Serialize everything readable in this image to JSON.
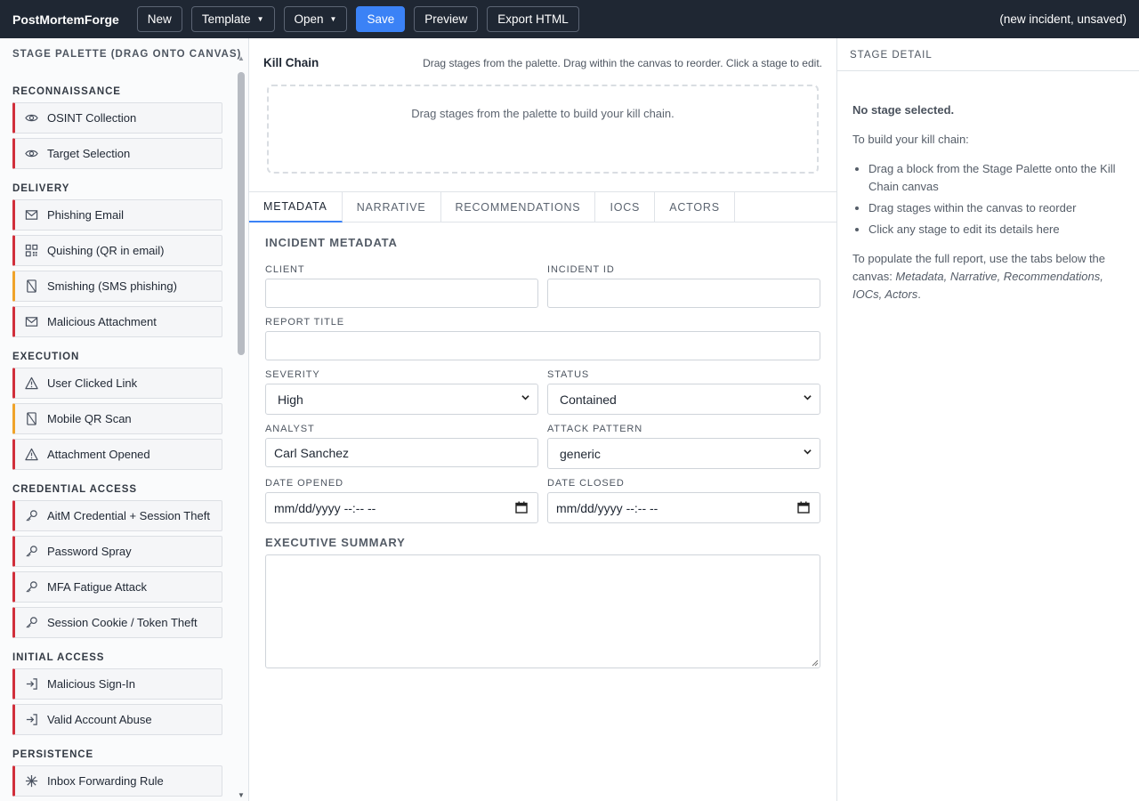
{
  "topbar": {
    "brand": "PostMortemForge",
    "new_label": "New",
    "template_label": "Template",
    "open_label": "Open",
    "save_label": "Save",
    "preview_label": "Preview",
    "export_label": "Export HTML",
    "status": "(new incident, unsaved)"
  },
  "palette": {
    "title": "STAGE PALETTE (DRAG ONTO CANVAS)",
    "categories": [
      {
        "name": "RECONNAISSANCE",
        "items": [
          {
            "label": "OSINT Collection",
            "icon": "eye-icon",
            "color": "#d12f3b"
          },
          {
            "label": "Target Selection",
            "icon": "eye-icon",
            "color": "#d12f3b"
          }
        ]
      },
      {
        "name": "DELIVERY",
        "items": [
          {
            "label": "Phishing Email",
            "icon": "envelope-icon",
            "color": "#d12f3b"
          },
          {
            "label": "Quishing (QR in email)",
            "icon": "qr-code-icon",
            "color": "#d12f3b"
          },
          {
            "label": "Smishing (SMS phishing)",
            "icon": "phone-icon",
            "color": "#f0a32a"
          },
          {
            "label": "Malicious Attachment",
            "icon": "envelope-icon",
            "color": "#d12f3b"
          }
        ]
      },
      {
        "name": "EXECUTION",
        "items": [
          {
            "label": "User Clicked Link",
            "icon": "warning-icon",
            "color": "#d12f3b"
          },
          {
            "label": "Mobile QR Scan",
            "icon": "phone-icon",
            "color": "#f0a32a"
          },
          {
            "label": "Attachment Opened",
            "icon": "warning-icon",
            "color": "#d12f3b"
          }
        ]
      },
      {
        "name": "CREDENTIAL ACCESS",
        "items": [
          {
            "label": "AitM Credential + Session Theft",
            "icon": "key-icon",
            "color": "#d12f3b"
          },
          {
            "label": "Password Spray",
            "icon": "key-icon",
            "color": "#d12f3b"
          },
          {
            "label": "MFA Fatigue Attack",
            "icon": "key-icon",
            "color": "#d12f3b"
          },
          {
            "label": "Session Cookie / Token Theft",
            "icon": "key-icon",
            "color": "#d12f3b"
          }
        ]
      },
      {
        "name": "INITIAL ACCESS",
        "items": [
          {
            "label": "Malicious Sign-In",
            "icon": "sign-in-icon",
            "color": "#d12f3b"
          },
          {
            "label": "Valid Account Abuse",
            "icon": "sign-in-icon",
            "color": "#d12f3b"
          }
        ]
      },
      {
        "name": "PERSISTENCE",
        "items": [
          {
            "label": "Inbox Forwarding Rule",
            "icon": "asterisk-icon",
            "color": "#d12f3b"
          }
        ]
      }
    ]
  },
  "killchain": {
    "title": "Kill Chain",
    "hint": "Drag stages from the palette. Drag within the canvas to reorder. Click a stage to edit.",
    "empty": "Drag stages from the palette to build your kill chain."
  },
  "tabs": [
    "METADATA",
    "NARRATIVE",
    "RECOMMENDATIONS",
    "IOCS",
    "ACTORS"
  ],
  "form": {
    "section_title": "INCIDENT METADATA",
    "client_label": "CLIENT",
    "client_value": "",
    "incident_id_label": "INCIDENT ID",
    "incident_id_value": "",
    "report_title_label": "REPORT TITLE",
    "report_title_value": "",
    "severity_label": "SEVERITY",
    "severity_value": "High",
    "status_label": "STATUS",
    "status_value": "Contained",
    "analyst_label": "ANALYST",
    "analyst_value": "Carl Sanchez",
    "attack_pattern_label": "ATTACK PATTERN",
    "attack_pattern_value": "generic",
    "date_opened_label": "DATE OPENED",
    "date_opened_value": "mm/dd/yyyy --:-- --",
    "date_closed_label": "DATE CLOSED",
    "date_closed_value": "mm/dd/yyyy --:-- --",
    "exec_summary_label": "EXECUTIVE SUMMARY",
    "exec_summary_value": ""
  },
  "detail": {
    "title": "STAGE DETAIL",
    "none": "No stage selected.",
    "intro": "To build your kill chain:",
    "steps": [
      "Drag a block from the Stage Palette onto the Kill Chain canvas",
      "Drag stages within the canvas to reorder",
      "Click any stage to edit its details here"
    ],
    "outro": "To populate the full report, use the tabs below the canvas: ",
    "outro_tabs": "Metadata, Narrative, Recommendations, IOCs, Actors",
    "outro_end": "."
  }
}
